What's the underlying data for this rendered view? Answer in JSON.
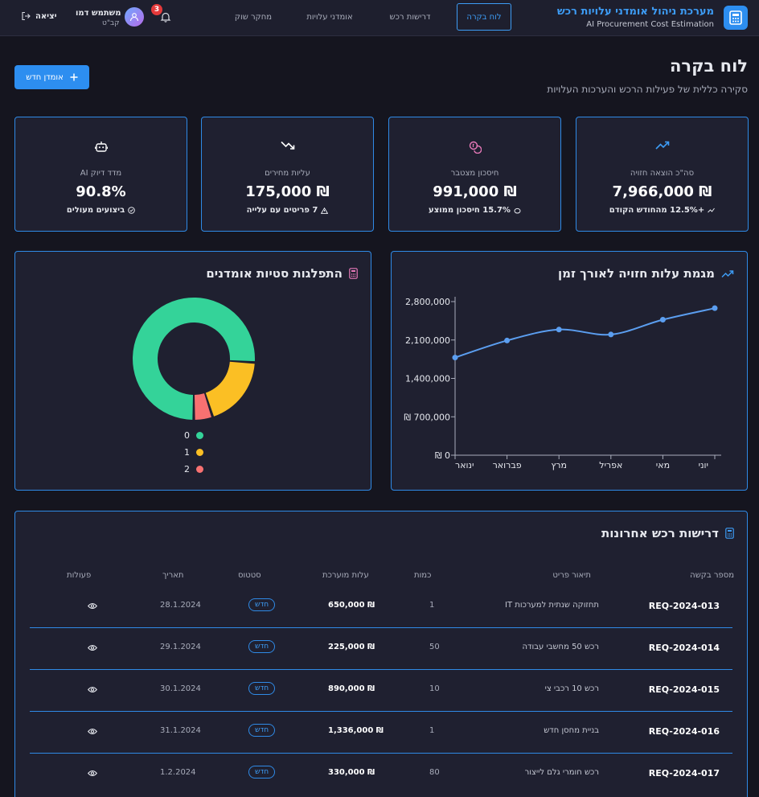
{
  "app": {
    "title": "מערכת ניהול אומדני עלויות רכש",
    "subtitle": "AI Procurement Cost Estimation",
    "brand_color": "#2d8ef0"
  },
  "nav": {
    "tabs": [
      {
        "label": "לוח בקרה",
        "active": true
      },
      {
        "label": "דרישות רכש",
        "active": false
      },
      {
        "label": "אומדני עלויות",
        "active": false
      },
      {
        "label": "מחקר שוק",
        "active": false
      }
    ],
    "notifications_count": "3",
    "user_name": "משתמש דמו",
    "user_role": "קב\"ט",
    "logout_label": "יציאה"
  },
  "page": {
    "title": "לוח בקרה",
    "subtitle": "סקירה כללית של פעילות הרכש והערכות העלויות",
    "new_button_label": "אומדן חדש"
  },
  "stats": [
    {
      "label": "סה\"כ הוצאה חזויה",
      "value": "₪ 7,966,000",
      "foot": "+12.5% מהחודש הקודם",
      "icon": "trending-up-icon",
      "color": "#3d9cf5"
    },
    {
      "label": "חיסכון מצטבר",
      "value": "₪ 991,000",
      "foot": "15.7% חיסכון ממוצע",
      "icon": "coins-icon",
      "color": "#e879b9"
    },
    {
      "label": "עליות מחירים",
      "value": "₪ 175,000",
      "foot": "7 פריטים עם עלייה",
      "icon": "trending-down-icon",
      "color": "#ffffff"
    },
    {
      "label": "מדד דיוק AI",
      "value": "90.8%",
      "foot": "ביצועים מעולים",
      "icon": "robot-icon",
      "color": "#ffffff"
    }
  ],
  "line_chart": {
    "title": "מגמת עלות חזויה לאורך זמן"
  },
  "donut_chart": {
    "title": "התפלגות סטיות אומדנים"
  },
  "chart_data": [
    {
      "type": "line",
      "title": "מגמת עלות חזויה לאורך זמן",
      "categories": [
        "ינואר",
        "פברואר",
        "מרץ",
        "אפריל",
        "מאי",
        "יוני"
      ],
      "values": [
        1780000,
        2090000,
        2290000,
        2200000,
        2470000,
        2680000
      ],
      "ylim": [
        0,
        2800000
      ],
      "yticks": [
        "₪ 0",
        "₪ 700,000",
        "2,100,000",
        "1,400,000",
        "2,800,000"
      ],
      "ytick_values": [
        0,
        700000,
        2100000,
        1400000,
        2800000
      ],
      "color": "#5b9ef0"
    },
    {
      "type": "pie",
      "title": "התפלגות סטיות אומדנים",
      "labels": [
        "0",
        "1",
        "2"
      ],
      "values": [
        76,
        19,
        5
      ],
      "colors": [
        "#34d399",
        "#fbbf24",
        "#f87171"
      ]
    }
  ],
  "table": {
    "title": "דרישות רכש אחרונות",
    "headers": [
      "מספר בקשה",
      "תיאור פריט",
      "כמות",
      "עלות מוערכת",
      "סטטוס",
      "תאריך",
      "פעולות"
    ],
    "rows": [
      {
        "req": "REQ-2024-013",
        "desc": "תחזוקה שנתית למערכות IT",
        "qty": "1",
        "cost": "₪ 650,000",
        "status": "חדש",
        "date": "28.1.2024"
      },
      {
        "req": "REQ-2024-014",
        "desc": "רכש 50 מחשבי עבודה",
        "qty": "50",
        "cost": "₪ 225,000",
        "status": "חדש",
        "date": "29.1.2024"
      },
      {
        "req": "REQ-2024-015",
        "desc": "רכש 10 רכבי צי",
        "qty": "10",
        "cost": "₪ 890,000",
        "status": "חדש",
        "date": "30.1.2024"
      },
      {
        "req": "REQ-2024-016",
        "desc": "בניית מחסן חדש",
        "qty": "1",
        "cost": "₪ 1,336,000",
        "status": "חדש",
        "date": "31.1.2024"
      },
      {
        "req": "REQ-2024-017",
        "desc": "רכש חומרי גלם לייצור",
        "qty": "80",
        "cost": "₪ 330,000",
        "status": "חדש",
        "date": "1.2.2024"
      }
    ]
  }
}
